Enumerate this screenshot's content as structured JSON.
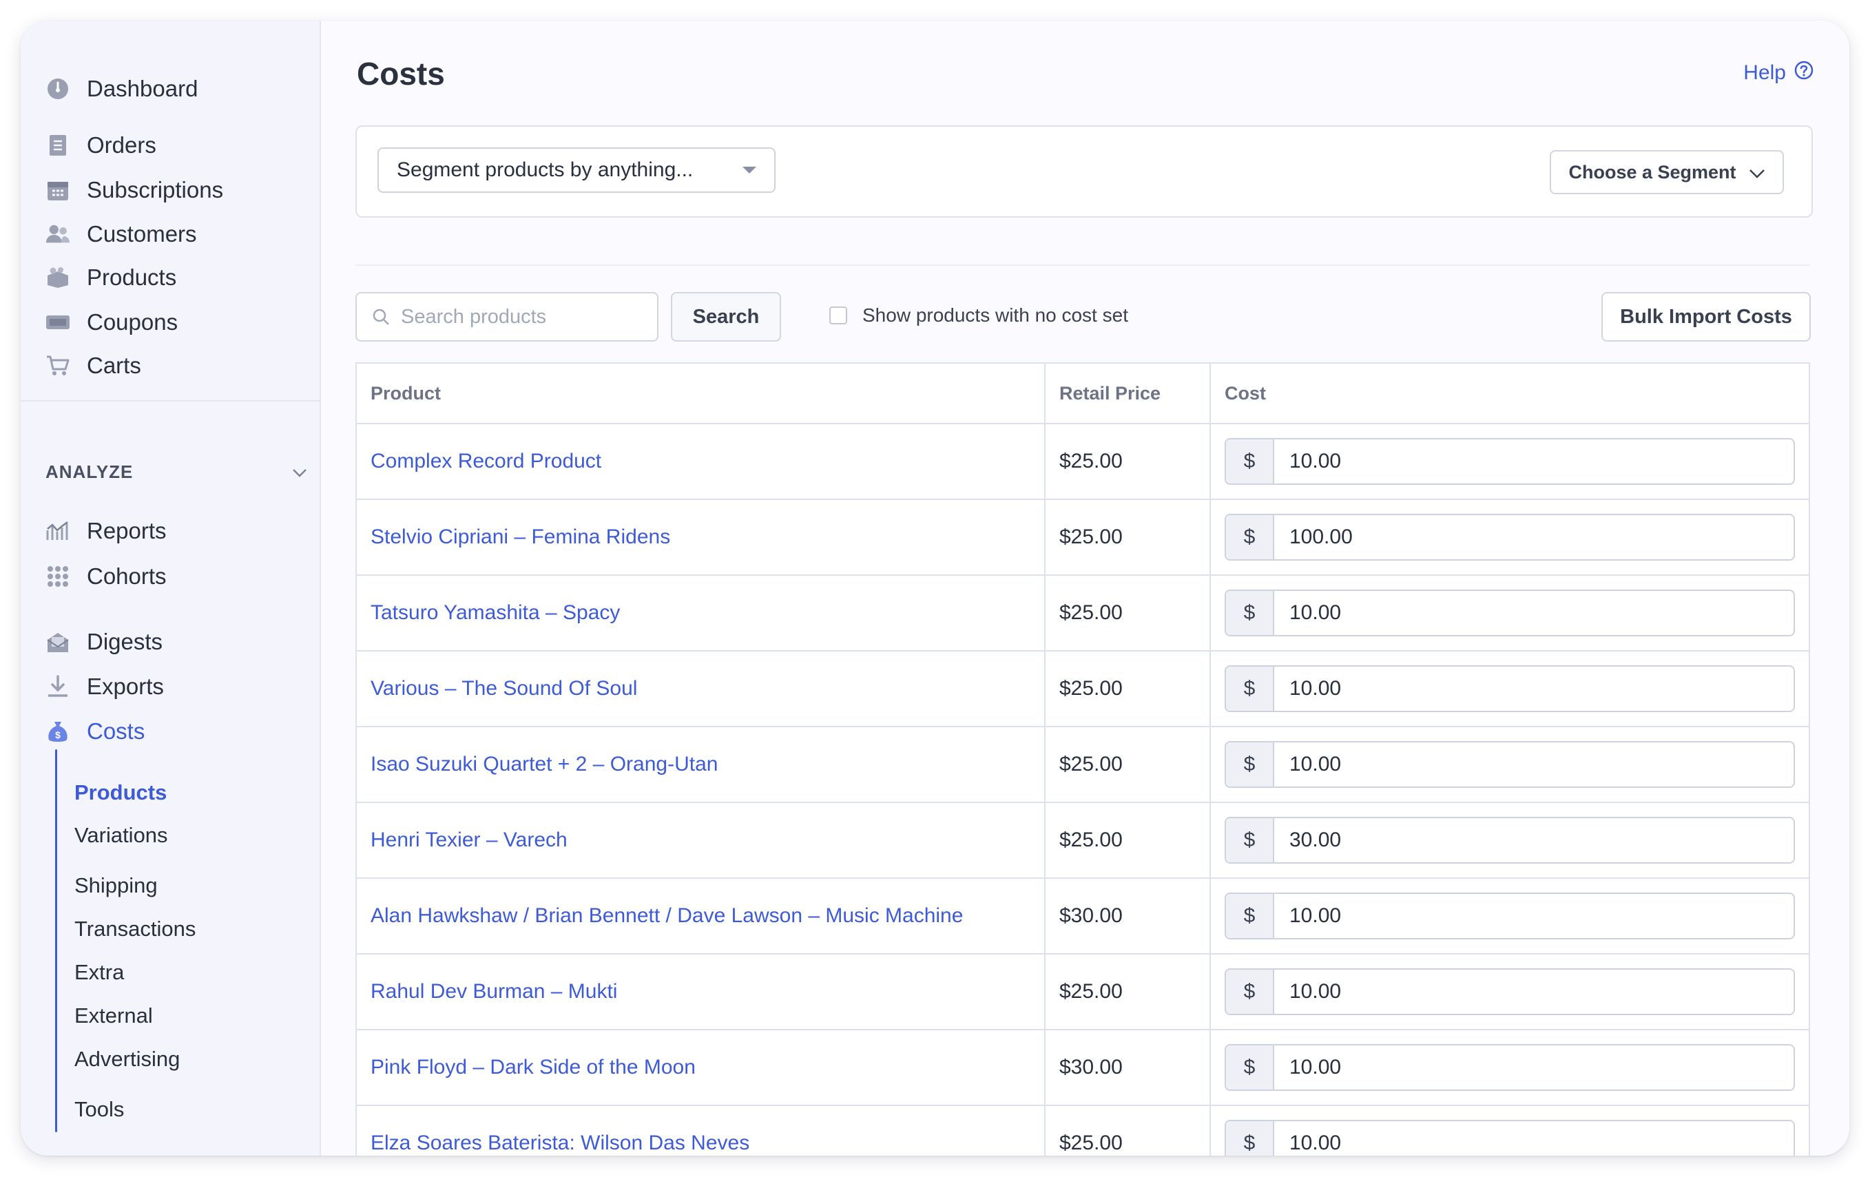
{
  "sidebar": {
    "nav": [
      {
        "label": "Dashboard",
        "icon": "dashboard-icon"
      },
      {
        "label": "Orders",
        "icon": "orders-icon"
      },
      {
        "label": "Subscriptions",
        "icon": "calendar-icon"
      },
      {
        "label": "Customers",
        "icon": "customers-icon"
      },
      {
        "label": "Products",
        "icon": "products-icon"
      },
      {
        "label": "Coupons",
        "icon": "coupon-icon"
      },
      {
        "label": "Carts",
        "icon": "cart-icon"
      }
    ],
    "analyze_heading": "ANALYZE",
    "analyze_items": [
      {
        "label": "Reports",
        "icon": "reports-icon"
      },
      {
        "label": "Cohorts",
        "icon": "cohorts-icon"
      },
      {
        "label": "Digests",
        "icon": "digests-icon"
      },
      {
        "label": "Exports",
        "icon": "download-icon"
      },
      {
        "label": "Costs",
        "icon": "money-bag-icon",
        "active": true
      }
    ],
    "costs_subnav": [
      {
        "label": "Products",
        "active": true
      },
      {
        "label": "Variations"
      },
      {
        "label": "Shipping"
      },
      {
        "label": "Transactions"
      },
      {
        "label": "Extra"
      },
      {
        "label": "External"
      },
      {
        "label": "Advertising"
      },
      {
        "label": "Tools"
      }
    ]
  },
  "header": {
    "title": "Costs",
    "help_label": "Help"
  },
  "segment": {
    "select_label": "Segment products by anything...",
    "choose_label": "Choose a Segment"
  },
  "toolbar": {
    "search_placeholder": "Search products",
    "search_button": "Search",
    "no_cost_checkbox_label": "Show products with no cost set",
    "bulk_import_label": "Bulk Import Costs"
  },
  "table": {
    "columns": [
      "Product",
      "Retail Price",
      "Cost"
    ],
    "currency_symbol": "$",
    "rows": [
      {
        "product": "Complex Record Product",
        "retail_price": "$25.00",
        "cost": "10.00"
      },
      {
        "product": "Stelvio Cipriani – Femina Ridens",
        "retail_price": "$25.00",
        "cost": "100.00"
      },
      {
        "product": "Tatsuro Yamashita – Spacy",
        "retail_price": "$25.00",
        "cost": "10.00"
      },
      {
        "product": "Various – The Sound Of Soul",
        "retail_price": "$25.00",
        "cost": "10.00"
      },
      {
        "product": "Isao Suzuki Quartet + 2 – Orang-Utan",
        "retail_price": "$25.00",
        "cost": "10.00"
      },
      {
        "product": "Henri Texier – Varech",
        "retail_price": "$25.00",
        "cost": "30.00"
      },
      {
        "product": "Alan Hawkshaw / Brian Bennett / Dave Lawson – Music Machine",
        "retail_price": "$30.00",
        "cost": "10.00"
      },
      {
        "product": "Rahul Dev Burman – Mukti",
        "retail_price": "$25.00",
        "cost": "10.00"
      },
      {
        "product": "Pink Floyd – Dark Side of the Moon",
        "retail_price": "$30.00",
        "cost": "10.00"
      },
      {
        "product": "Elza Soares Baterista: Wilson Das Neves",
        "retail_price": "$25.00",
        "cost": "10.00"
      }
    ]
  },
  "colors": {
    "accent": "#3d5bd9",
    "sidebar_bg": "#f3f4fc",
    "border": "#dde1ee"
  }
}
